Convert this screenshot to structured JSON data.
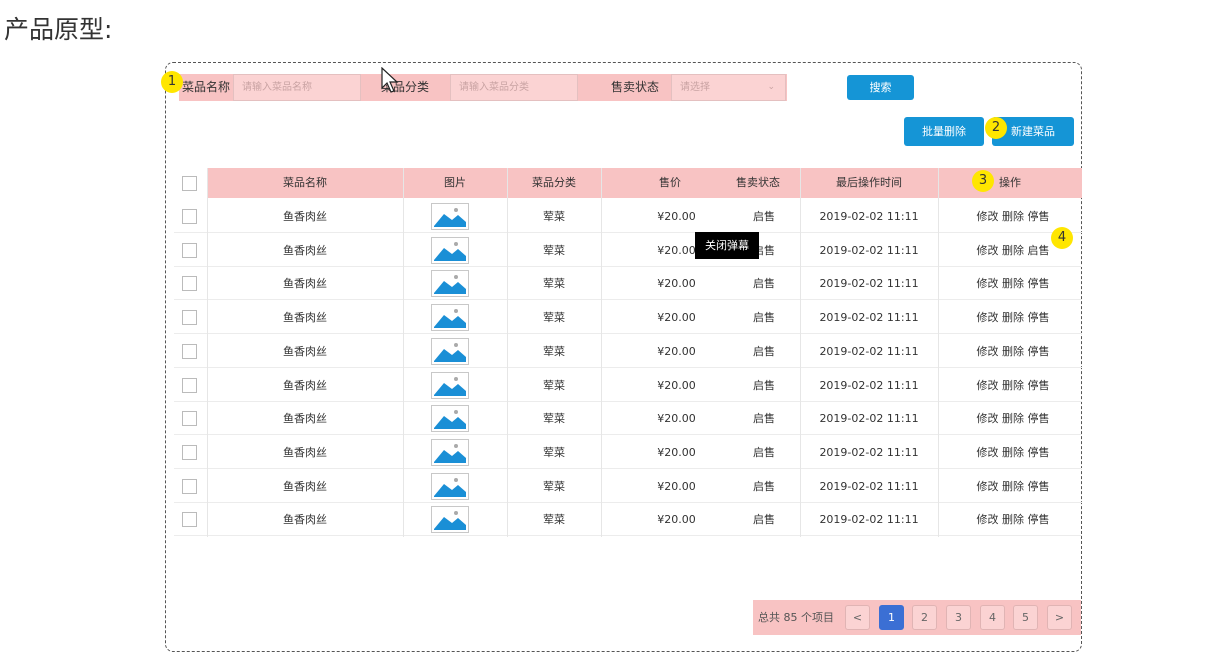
{
  "page_heading": "产品原型:",
  "filter": {
    "name_label": "菜品名称",
    "name_placeholder": "请输入菜品名称",
    "category_label": "菜品分类",
    "category_placeholder": "请输入菜品分类",
    "status_label": "售卖状态",
    "status_placeholder": "请选择"
  },
  "buttons": {
    "search": "搜索",
    "batch_delete": "批量删除",
    "new_dish": "新建菜品"
  },
  "markers": [
    "1",
    "2",
    "3",
    "4"
  ],
  "table": {
    "headers": [
      "菜品名称",
      "图片",
      "菜品分类",
      "售价",
      "售卖状态",
      "最后操作时间",
      "操作"
    ],
    "rows": [
      {
        "name": "鱼香肉丝",
        "category": "荤菜",
        "price": "¥20.00",
        "status": "启售",
        "time": "2019-02-02 11:11",
        "op1": "修改",
        "op2": "删除",
        "op3": "停售"
      },
      {
        "name": "鱼香肉丝",
        "category": "荤菜",
        "price": "¥20.00",
        "status": "启售",
        "time": "2019-02-02 11:11",
        "op1": "修改",
        "op2": "删除",
        "op3": "启售"
      },
      {
        "name": "鱼香肉丝",
        "category": "荤菜",
        "price": "¥20.00",
        "status": "启售",
        "time": "2019-02-02 11:11",
        "op1": "修改",
        "op2": "删除",
        "op3": "停售"
      },
      {
        "name": "鱼香肉丝",
        "category": "荤菜",
        "price": "¥20.00",
        "status": "启售",
        "time": "2019-02-02 11:11",
        "op1": "修改",
        "op2": "删除",
        "op3": "停售"
      },
      {
        "name": "鱼香肉丝",
        "category": "荤菜",
        "price": "¥20.00",
        "status": "启售",
        "time": "2019-02-02 11:11",
        "op1": "修改",
        "op2": "删除",
        "op3": "停售"
      },
      {
        "name": "鱼香肉丝",
        "category": "荤菜",
        "price": "¥20.00",
        "status": "启售",
        "time": "2019-02-02 11:11",
        "op1": "修改",
        "op2": "删除",
        "op3": "停售"
      },
      {
        "name": "鱼香肉丝",
        "category": "荤菜",
        "price": "¥20.00",
        "status": "启售",
        "time": "2019-02-02 11:11",
        "op1": "修改",
        "op2": "删除",
        "op3": "停售"
      },
      {
        "name": "鱼香肉丝",
        "category": "荤菜",
        "price": "¥20.00",
        "status": "启售",
        "time": "2019-02-02 11:11",
        "op1": "修改",
        "op2": "删除",
        "op3": "停售"
      },
      {
        "name": "鱼香肉丝",
        "category": "荤菜",
        "price": "¥20.00",
        "status": "启售",
        "time": "2019-02-02 11:11",
        "op1": "修改",
        "op2": "删除",
        "op3": "停售"
      },
      {
        "name": "鱼香肉丝",
        "category": "荤菜",
        "price": "¥20.00",
        "status": "启售",
        "time": "2019-02-02 11:11",
        "op1": "修改",
        "op2": "删除",
        "op3": "停售"
      }
    ]
  },
  "tooltip": "关闭弹幕",
  "pagination": {
    "total": "总共 85 个项目",
    "prev": "<",
    "pages": [
      "1",
      "2",
      "3",
      "4",
      "5"
    ],
    "active_page": "1",
    "next": ">"
  },
  "colors": {
    "annotation_pink": "#f8c3c3",
    "button_blue": "#1595d6",
    "marker_yellow": "#ffe600",
    "page_active": "#3b6fd4",
    "image_icon_blue": "#1a8fd6"
  }
}
